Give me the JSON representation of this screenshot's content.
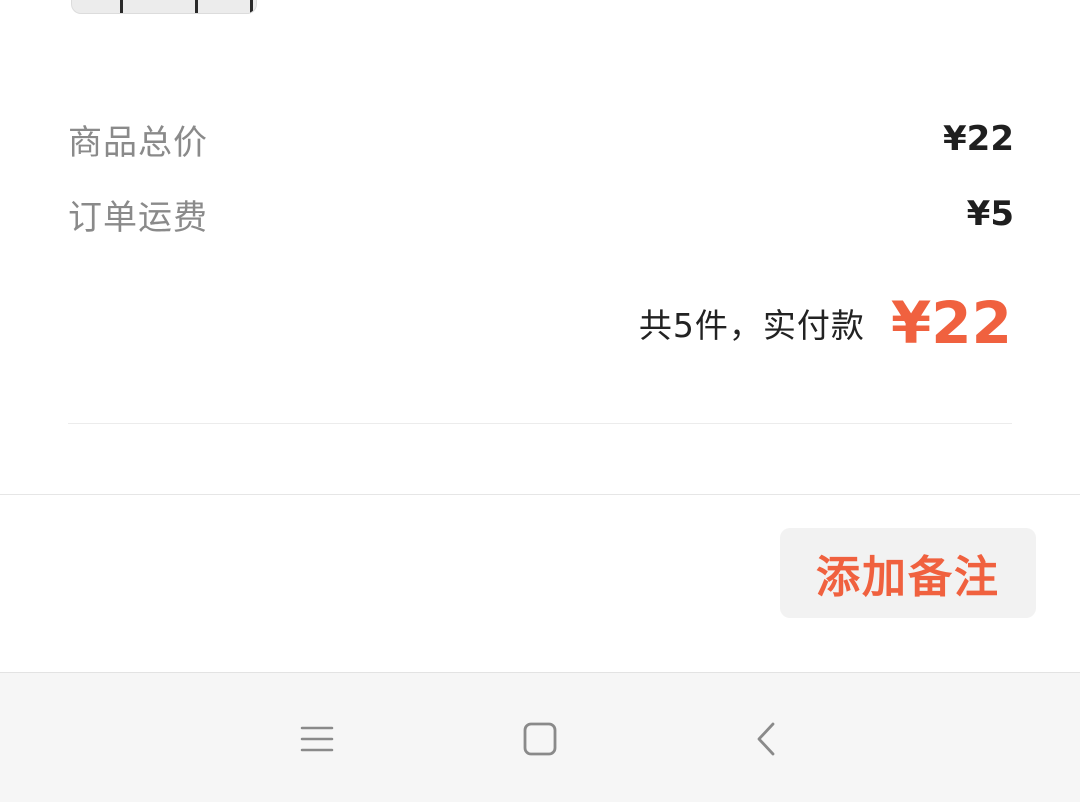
{
  "order_summary": {
    "goods_total_label": "商品总价",
    "goods_total_value": "¥22",
    "shipping_label": "订单运费",
    "shipping_value": "¥5",
    "total_text": "共5件，实付款",
    "total_amount": "¥22"
  },
  "actions": {
    "add_note_label": "添加备注"
  },
  "colors": {
    "accent": "#f0613f",
    "label_gray": "#8a8a8a",
    "button_bg": "#f2f2f2",
    "navbar_bg": "#f6f6f6"
  },
  "navbar": {
    "icons": [
      "menu-icon",
      "home-square-icon",
      "back-chevron-icon"
    ]
  }
}
